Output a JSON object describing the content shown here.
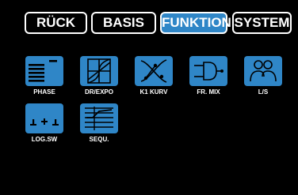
{
  "tabs": {
    "back": "RÜCK",
    "basis": "BASIS",
    "funktion": "FUNKTION",
    "system": "SYSTEM",
    "active": "funktion"
  },
  "tiles": [
    {
      "label": "PHASE",
      "icon": "phase-icon"
    },
    {
      "label": "DR/EXPO",
      "icon": "dr-expo-icon"
    },
    {
      "label": "K1 KURV",
      "icon": "k1-curve-icon"
    },
    {
      "label": "FR. MIX",
      "icon": "free-mix-icon"
    },
    {
      "label": "L/S",
      "icon": "logic-switch-icon"
    },
    {
      "label": "LOG.SW",
      "icon": "log-sw-icon"
    },
    {
      "label": "SEQU.",
      "icon": "sequencer-icon"
    }
  ],
  "colors": {
    "background": "#000000",
    "accent": "#2f86c7",
    "foreground": "#ffffff"
  }
}
